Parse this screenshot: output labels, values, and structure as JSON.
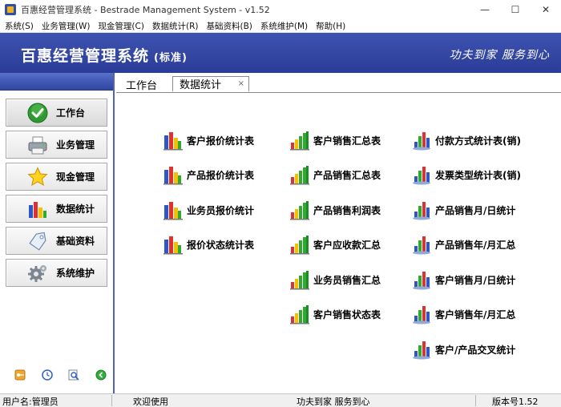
{
  "window": {
    "title": "百惠经营管理系统 - Bestrade Management System - v1.52",
    "minimize": "—",
    "maximize": "☐",
    "close": "✕"
  },
  "menu": [
    "系统(S)",
    "业务管理(W)",
    "现金管理(C)",
    "数据统计(R)",
    "基础资料(B)",
    "系统维护(M)",
    "帮助(H)"
  ],
  "banner": {
    "title": "百惠经营管理系统",
    "subtitle": "(标准)",
    "slogan": "功夫到家 服务到心"
  },
  "sidebar": {
    "items": [
      {
        "label": "工作台",
        "icon": "checkmark-icon"
      },
      {
        "label": "业务管理",
        "icon": "printer-icon"
      },
      {
        "label": "现金管理",
        "icon": "star-icon"
      },
      {
        "label": "数据统计",
        "icon": "bar-chart-icon"
      },
      {
        "label": "基础资料",
        "icon": "tag-icon"
      },
      {
        "label": "系统维护",
        "icon": "gear-icon"
      }
    ],
    "bottom_icons": [
      "key-icon",
      "clock-icon",
      "search-icon",
      "exit-icon"
    ]
  },
  "tabs": [
    {
      "label": "工作台"
    },
    {
      "label": "数据统计",
      "close": "×"
    }
  ],
  "reports": {
    "col1": [
      "客户报价统计表",
      "产品报价统计表",
      "业务员报价统计",
      "报价状态统计表"
    ],
    "col2": [
      "客户销售汇总表",
      "产品销售汇总表",
      "产品销售利润表",
      "客户应收款汇总",
      "业务员销售汇总",
      "客户销售状态表"
    ],
    "col3": [
      "付款方式统计表(销)",
      "发票类型统计表(销)",
      "产品销售月/日统计",
      "产品销售年/月汇总",
      "客户销售月/日统计",
      "客户销售年/月汇总",
      "客户/产品交叉统计"
    ]
  },
  "status": {
    "user": "用户名:管理员",
    "welcome": "欢迎使用",
    "slogan": "功夫到家 服务到心",
    "version": "版本号1.52"
  },
  "colors": {
    "banner": "#2a3c97",
    "accent": "#3f58b4"
  }
}
